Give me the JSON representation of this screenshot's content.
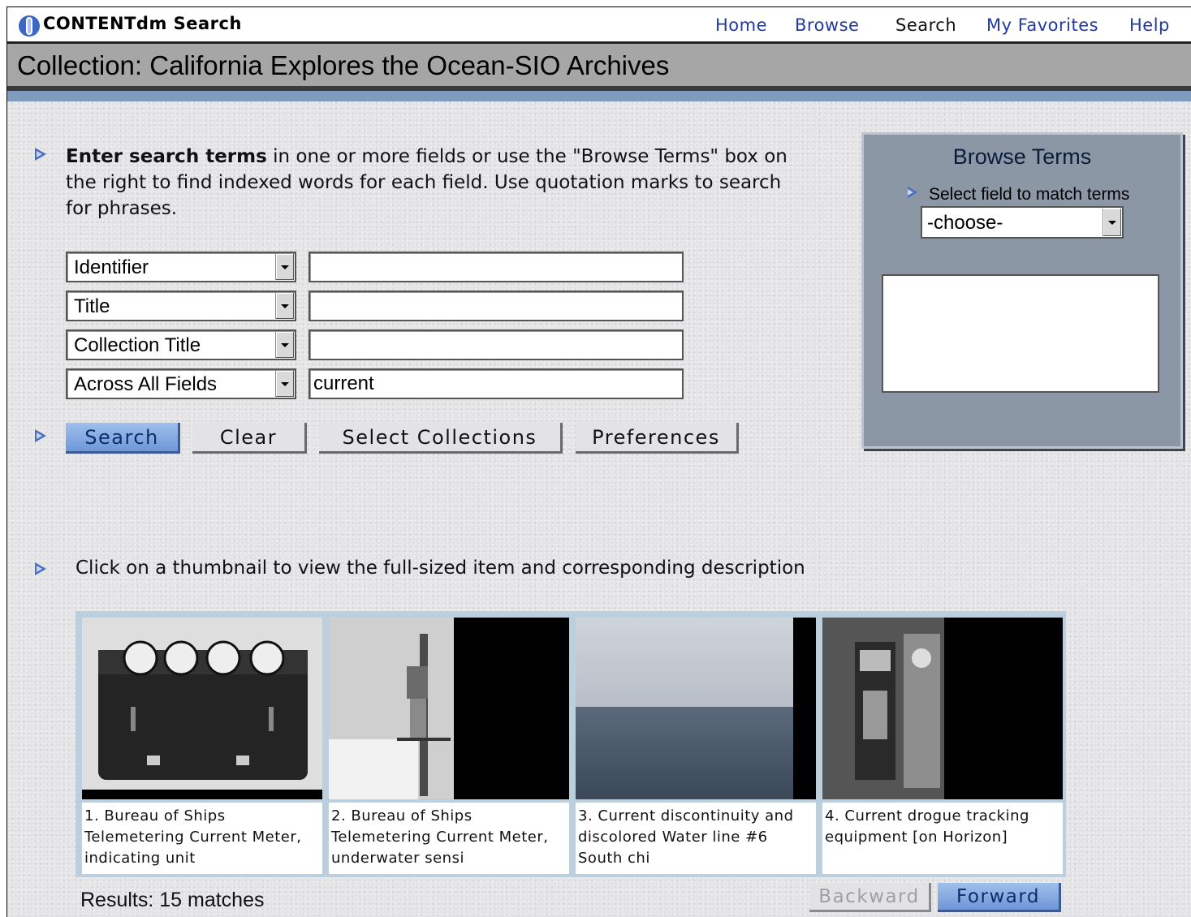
{
  "app": {
    "title": "CONTENTdm Search"
  },
  "nav": [
    "Home",
    "Browse",
    "Search",
    "My Favorites",
    "Help"
  ],
  "collection_title": "Collection: California Explores the Ocean-SIO Archives",
  "intro": {
    "bold": "Enter search terms",
    "rest": " in one or more fields or use the \"Browse Terms\" box on the right to find indexed words for each field. Use quotation marks to search for phrases."
  },
  "search_rows": [
    {
      "field": "Identifier",
      "value": ""
    },
    {
      "field": "Title",
      "value": ""
    },
    {
      "field": "Collection Title",
      "value": ""
    },
    {
      "field": "Across All Fields",
      "value": "current"
    }
  ],
  "buttons": {
    "search": "Search",
    "clear": "Clear",
    "select_collections": "Select Collections",
    "preferences": "Preferences"
  },
  "browse_terms": {
    "title": "Browse Terms",
    "subtitle": "Select field to match terms",
    "select_value": "-choose-"
  },
  "thumbnail_note": "Click on a thumbnail to view the full-sized item and corresponding description",
  "results": [
    {
      "caption": "1. Bureau of Ships Telemetering Current Meter, indicating unit"
    },
    {
      "caption": "2. Bureau of Ships Telemetering Current Meter, underwater sensi"
    },
    {
      "caption": "3. Current discontinuity and discolored Water line #6 South chi"
    },
    {
      "caption": "4. Current drogue tracking equipment [on Horizon]"
    }
  ],
  "results_count": "Results: 15 matches",
  "pager": {
    "backward": "Backward",
    "forward": "Forward"
  },
  "colors": {
    "link": "#1f3aa3",
    "accent": "#4a6fc0",
    "panel": "#8c97a6"
  }
}
